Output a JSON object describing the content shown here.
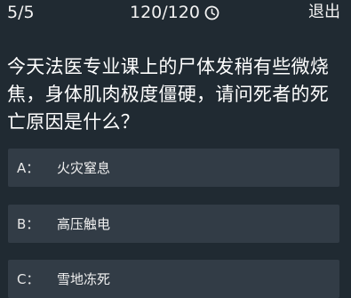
{
  "header": {
    "progress": "5/5",
    "timer": "120/120",
    "timer_icon": "clock-icon",
    "exit_label": "退出"
  },
  "question": {
    "text": "今天法医专业课上的尸体发稍有些微烧焦，身体肌肉极度僵硬，请问死者的死亡原因是什么？"
  },
  "options": [
    {
      "key": "A：",
      "text": "火灾窒息"
    },
    {
      "key": "B：",
      "text": "高压触电"
    },
    {
      "key": "C：",
      "text": "雪地冻死"
    }
  ],
  "colors": {
    "background": "#202a32",
    "option_background": "#323c46",
    "text": "#ffffff"
  }
}
